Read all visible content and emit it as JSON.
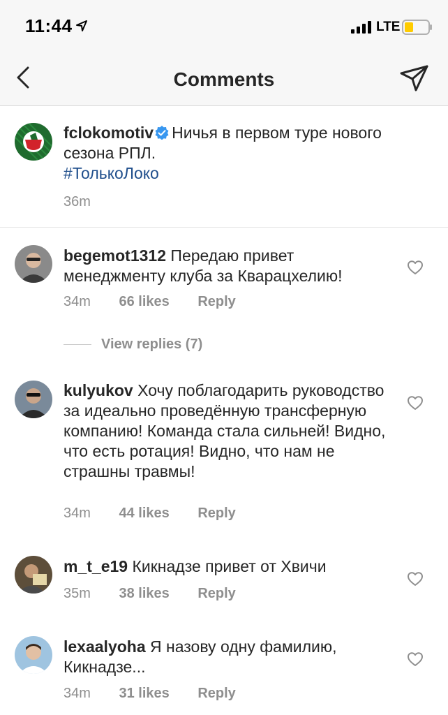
{
  "status_bar": {
    "time": "11:44",
    "network": "LTE"
  },
  "nav": {
    "title": "Comments"
  },
  "caption": {
    "username": "fclokomotiv",
    "text": "Ничья в первом туре нового сезона РПЛ.",
    "hashtag": "#ТолькоЛоко",
    "time": "36m"
  },
  "comments": [
    {
      "username": "begemot1312",
      "text": "Передаю привет менеджменту клуба за Кварацхелию!",
      "time": "34m",
      "likes": "66 likes",
      "reply": "Reply"
    },
    {
      "username": "kulyukov",
      "text": "Хочу поблагодарить руководство за идеально проведённую трансферную компанию! Команда стала сильней! Видно, что есть ротация! Видно, что нам не страшны травмы!",
      "time": "34m",
      "likes": "44 likes",
      "reply": "Reply"
    },
    {
      "username": "m_t_e19",
      "text": "Кикнадзе привет от Хвичи",
      "time": "35m",
      "likes": "38 likes",
      "reply": "Reply"
    },
    {
      "username": "lexaalyoha",
      "text": "Я назову одну фамилию, Кикнадзе...",
      "time": "34m",
      "likes": "31 likes",
      "reply": "Reply"
    }
  ],
  "view_replies": "View replies (7)",
  "icons": {
    "back": "chevron-left-icon",
    "send": "paper-plane-icon",
    "like": "heart-outline-icon",
    "verified": "verified-badge-icon",
    "location": "location-arrow-icon",
    "signal": "cellular-signal-icon",
    "battery": "battery-low-icon"
  },
  "colors": {
    "text": "#262626",
    "secondary": "#8e8e8e",
    "hashtag": "#1f4e8c",
    "verified": "#3897f0",
    "battery": "#ffcc00",
    "bar_background": "#f7f7f7"
  }
}
